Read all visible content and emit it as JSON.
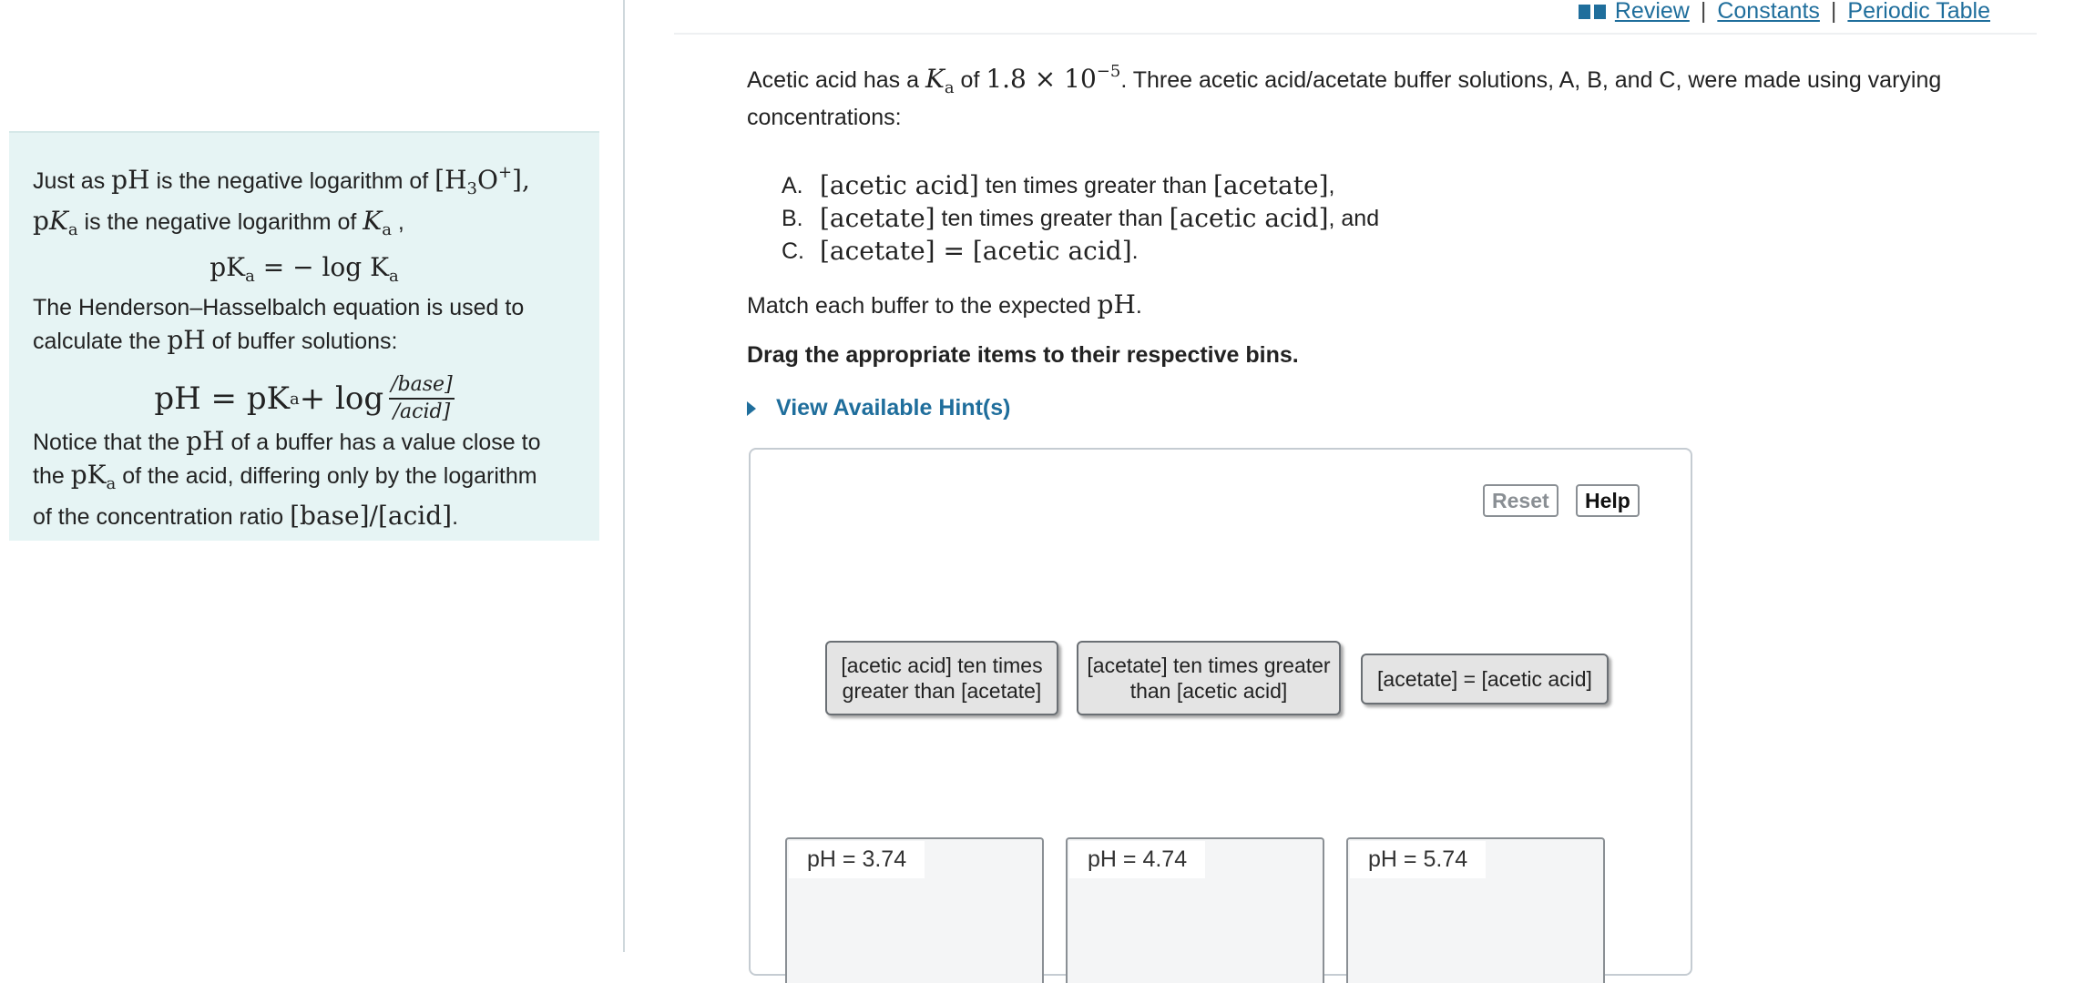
{
  "links": {
    "review": "Review",
    "constants": "Constants",
    "periodic_table": "Periodic Table",
    "sep": "|"
  },
  "intro": {
    "l1_a": "Just as ",
    "l1_ph": "pH",
    "l1_b": " is the negative logarithm of ",
    "l1_h3o": "[H",
    "l1_3": "3",
    "l1_o": "O",
    "l1_plus": "+",
    "l1_end": "],",
    "l2_p": "p",
    "l2_K": "K",
    "l2_a": "a",
    "l2_b": " is the negative logarithm of ",
    "l2_K2": "K",
    "l2_a2": "a",
    "l2_end": " ,",
    "eq1_lhs": "pK",
    "eq1_a": "a",
    "eq1_mid": " = − log K",
    "eq1_a2": "a",
    "l3": "The Henderson–Hasselbalch equation is used to",
    "l4_a": "calculate the ",
    "l4_ph": "pH",
    "l4_b": " of buffer solutions:",
    "hh_lhs": "pH = pK",
    "hh_a": "a",
    "hh_mid": " + log",
    "hh_num": "/base]",
    "hh_den": "/acid]",
    "l5_a": "Notice that the ",
    "l5_ph": "pH",
    "l5_b": " of a buffer has a value close to",
    "l6_a": "the ",
    "l6_p": "pK",
    "l6_sub": "a",
    "l6_b": " of the acid, differing only by the logarithm",
    "l7_a": "of the concentration ratio ",
    "l7_ratio": "[base]/[acid]",
    "l7_end": "."
  },
  "question": {
    "q_a": "Acetic acid has a ",
    "q_K": "K",
    "q_sub": "a",
    "q_b": " of ",
    "q_val": "1.8 × 10",
    "q_exp": "−5",
    "q_c": ". Three acetic acid/acetate buffer solutions, A, B, and C, were made using varying concentrations:",
    "options": [
      {
        "letter": "A.",
        "m1": "[acetic acid]",
        "t1": " ten times greater than ",
        "m2": "[acetate]",
        "t2": ","
      },
      {
        "letter": "B.",
        "m1": "[acetate]",
        "t1": " ten times greater than ",
        "m2": "[acetic acid]",
        "t2": ", and"
      },
      {
        "letter": "C.",
        "m1": "[acetate] = [acetic acid]",
        "t1": "",
        "m2": "",
        "t2": "."
      }
    ],
    "match_a": "Match each buffer to the expected ",
    "match_ph": "pH",
    "match_end": ".",
    "drag": "Drag the appropriate items to their respective bins.",
    "hint": "View Available Hint(s)"
  },
  "drag_area": {
    "reset": "Reset",
    "help": "Help",
    "items": [
      "[acetic acid] ten times greater than [acetate]",
      "[acetate] ten times greater than [acetic acid]",
      "[acetate] = [acetic acid]"
    ],
    "bins": [
      "pH = 3.74",
      "pH = 4.74",
      "pH = 5.74"
    ]
  }
}
